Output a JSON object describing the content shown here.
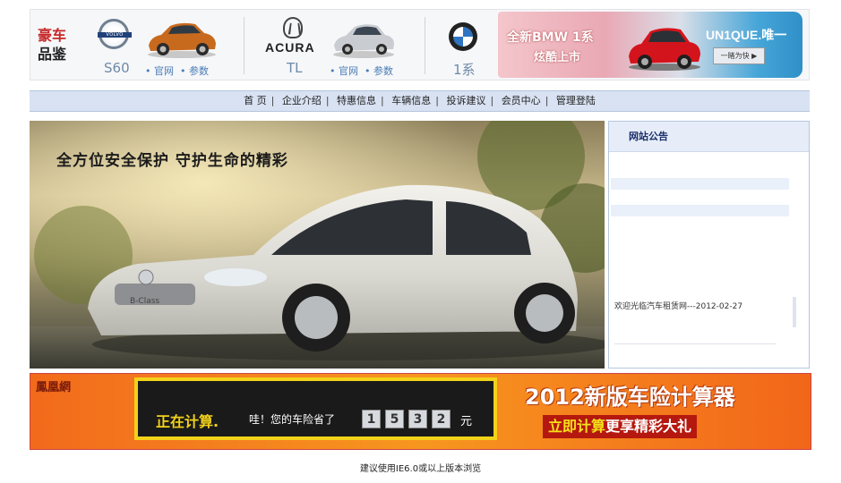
{
  "banner": {
    "brand_line1": "豪车",
    "brand_line2": "品鉴",
    "volvo": {
      "logo_text": "VOLVO",
      "model": "S60",
      "link_site": "• 官网",
      "link_params": "• 参数"
    },
    "acura": {
      "logo_text": "ACURA",
      "model": "TL",
      "link_site": "• 官网",
      "link_params": "• 参数"
    },
    "bmw": {
      "model": "1系",
      "promo_line1": "全新BMW 1系",
      "promo_line2": "炫酷上市",
      "promo_slogan": "UN1QUE.唯一",
      "promo_button": "一睹为快 ▶"
    }
  },
  "nav": {
    "items": [
      "首 页",
      "企业介绍",
      "特惠信息",
      "车辆信息",
      "投诉建议",
      "会员中心",
      "管理登陆"
    ]
  },
  "hero": {
    "slogan": "全方位安全保护  守护生命的精彩",
    "car_badge": "B-Class"
  },
  "notice": {
    "title": "网站公告",
    "message": "欢迎光临汽车租赁网---2012-02-27"
  },
  "ad": {
    "logo": "鳳凰網",
    "computing": "正在计算.",
    "saved_text": "哇！您的车险省了",
    "digits": [
      "1",
      "5",
      "3",
      "2"
    ],
    "unit": "元",
    "headline": "2012新版车险计算器",
    "cta_highlight": "立即计算",
    "cta_rest": "更享精彩大礼"
  },
  "footer": {
    "text": "建议使用IE6.0或以上版本浏览"
  },
  "colors": {
    "nav_bg": "#d8e2f2",
    "notice_title": "#1b2e6b",
    "ad_orange": "#f7961f",
    "brand_red": "#c62828"
  }
}
